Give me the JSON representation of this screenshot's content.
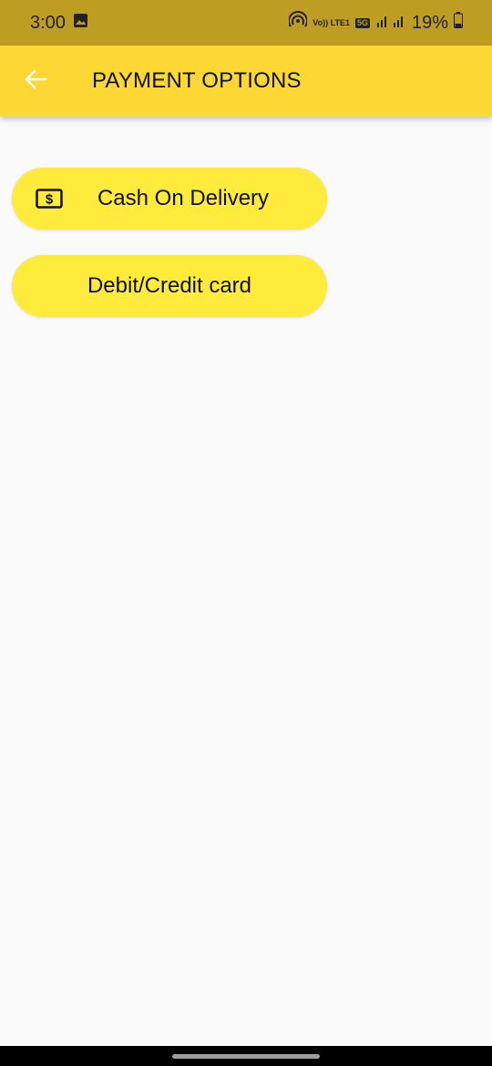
{
  "status_bar": {
    "time": "3:00",
    "network_mark": "Vo)) LTE1",
    "five_g": "5G",
    "battery_percent": "19%",
    "icons": [
      "image-icon",
      "hotspot-icon",
      "signal-icon",
      "battery-icon"
    ]
  },
  "header": {
    "title": "PAYMENT OPTIONS",
    "back_icon": "arrow-left-icon"
  },
  "payment_options": [
    {
      "label": "Cash On Delivery",
      "icon": "cash-icon"
    },
    {
      "label": "Debit/Credit card"
    }
  ],
  "colors": {
    "status_bar": "#bd9e22",
    "app_bar": "#fdd835",
    "button": "#ffeb3b",
    "background": "#fafafa"
  }
}
